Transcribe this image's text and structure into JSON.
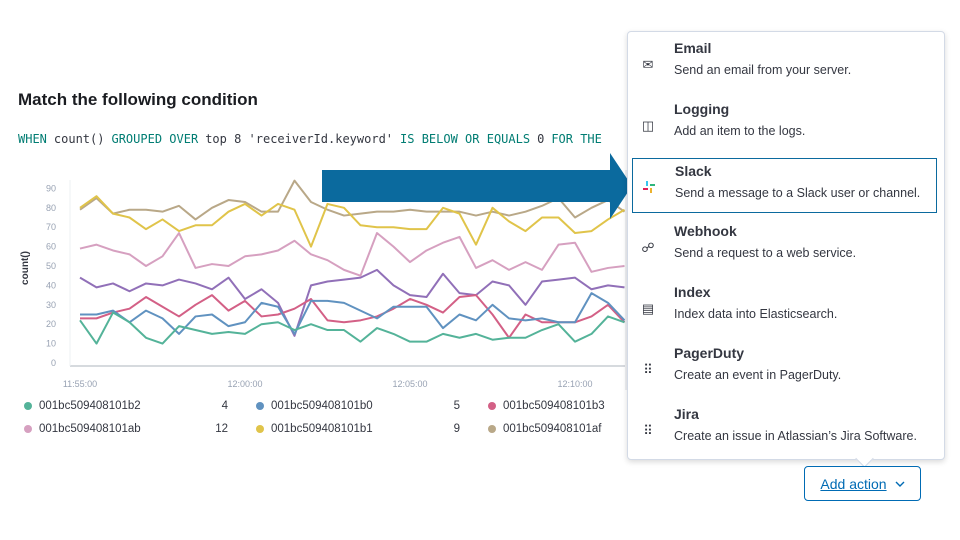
{
  "condition": {
    "title": "Match the following condition",
    "expression": [
      {
        "text": "WHEN",
        "kind": "kw"
      },
      {
        "text": "count()",
        "kind": "val"
      },
      {
        "text": "GROUPED OVER",
        "kind": "kw"
      },
      {
        "text": "top 8 'receiverId.keyword'",
        "kind": "val"
      },
      {
        "text": "IS BELOW OR EQUALS",
        "kind": "kw"
      },
      {
        "text": "0",
        "kind": "val"
      },
      {
        "text": "FOR THE",
        "kind": "kw"
      }
    ]
  },
  "chart_data": {
    "type": "line",
    "ylabel": "count()",
    "xlabel": "",
    "ylim": [
      0,
      95
    ],
    "yticks": [
      0,
      10,
      20,
      30,
      40,
      50,
      60,
      70,
      80,
      90
    ],
    "xtick_labels": [
      "11:55:00",
      "12:00:00",
      "12:05:00",
      "12:10:00"
    ],
    "x_start": "11:55:00",
    "x_interval_seconds": 30,
    "grid": false,
    "legend": "bottom",
    "series": [
      {
        "name": "001bc509408101b2",
        "legend_value": "4",
        "color": "#54b399",
        "values": [
          22,
          10,
          26,
          21,
          13,
          10,
          19,
          17,
          15,
          16,
          15,
          20,
          21,
          17,
          20,
          17,
          17,
          11,
          18,
          15,
          11,
          11,
          15,
          13,
          15,
          12,
          13,
          13,
          17,
          20,
          11,
          15,
          24,
          21
        ]
      },
      {
        "name": "001bc509408101b0",
        "legend_value": "5",
        "color": "#6092c0",
        "values": [
          25,
          25,
          27,
          21,
          27,
          23,
          15,
          24,
          25,
          19,
          21,
          31,
          29,
          15,
          32,
          32,
          31,
          27,
          23,
          29,
          29,
          29,
          18,
          25,
          22,
          30,
          23,
          22,
          23,
          21,
          21,
          36,
          31,
          22
        ]
      },
      {
        "name": "001bc509408101b3",
        "legend_value": "",
        "color": "#d36086",
        "values": [
          23,
          23,
          26,
          28,
          34,
          29,
          24,
          30,
          35,
          27,
          32,
          24,
          25,
          28,
          33,
          22,
          21,
          22,
          24,
          28,
          33,
          30,
          26,
          34,
          35,
          25,
          13,
          25,
          21,
          21,
          21,
          24,
          30,
          21
        ]
      },
      {
        "name": "001bc509408101ab",
        "legend_value": "12",
        "color": "#d6a0c0",
        "values": [
          59,
          61,
          58,
          56,
          50,
          55,
          67,
          49,
          51,
          50,
          55,
          56,
          58,
          63,
          56,
          53,
          48,
          45,
          67,
          60,
          52,
          58,
          62,
          65,
          49,
          53,
          48,
          52,
          48,
          61,
          62,
          47,
          49,
          50
        ]
      },
      {
        "name": "001bc509408101b1",
        "legend_value": "9",
        "color": "#e0c44a",
        "values": [
          80,
          86,
          77,
          75,
          69,
          74,
          68,
          71,
          71,
          78,
          82,
          76,
          82,
          79,
          60,
          82,
          80,
          71,
          70,
          70,
          69,
          69,
          80,
          77,
          61,
          80,
          73,
          68,
          75,
          75,
          67,
          68,
          74,
          79
        ]
      },
      {
        "name": "001bc509408101af",
        "legend_value": "",
        "color": "#b9a888",
        "values": [
          79,
          85,
          77,
          79,
          79,
          78,
          81,
          74,
          80,
          84,
          83,
          78,
          78,
          94,
          83,
          79,
          76,
          77,
          78,
          78,
          79,
          78,
          78,
          78,
          76,
          78,
          76,
          78,
          81,
          85,
          75,
          80,
          84,
          78
        ]
      },
      {
        "color": "#9170b8",
        "values": [
          44,
          39,
          41,
          37,
          41,
          40,
          43,
          41,
          38,
          44,
          33,
          38,
          31,
          14,
          40,
          42,
          43,
          44,
          48,
          40,
          35,
          34,
          46,
          36,
          35,
          42,
          40,
          30,
          42,
          43,
          44,
          38,
          40,
          39
        ]
      }
    ]
  },
  "menu": {
    "items": [
      {
        "label": "Email",
        "description": "Send an email from your server.",
        "icon": "mail-icon",
        "glyph": "✉"
      },
      {
        "label": "Logging",
        "description": "Add an item to the logs.",
        "icon": "logging-icon",
        "glyph": "◫"
      },
      {
        "label": "Slack",
        "description": "Send a message to a Slack user or channel.",
        "icon": "slack-icon",
        "glyph": "#"
      },
      {
        "label": "Webhook",
        "description": "Send a request to a web service.",
        "icon": "webhook-icon",
        "glyph": "☍"
      },
      {
        "label": "Index",
        "description": "Index data into Elasticsearch.",
        "icon": "index-icon",
        "glyph": "▤"
      },
      {
        "label": "PagerDuty",
        "description": "Create an event in PagerDuty.",
        "icon": "apps-grid-icon",
        "glyph": "⠿"
      },
      {
        "label": "Jira",
        "description": "Create an issue in Atlassian’s Jira Software.",
        "icon": "apps-grid-icon",
        "glyph": "⠿"
      }
    ],
    "selected": "Slack"
  },
  "add_action": {
    "label": "Add action",
    "icon": "chevron-down-icon"
  },
  "colors": {
    "accent": "#006bb4",
    "highlight_arrow": "#0b6a9e",
    "keyword": "#017d73"
  }
}
